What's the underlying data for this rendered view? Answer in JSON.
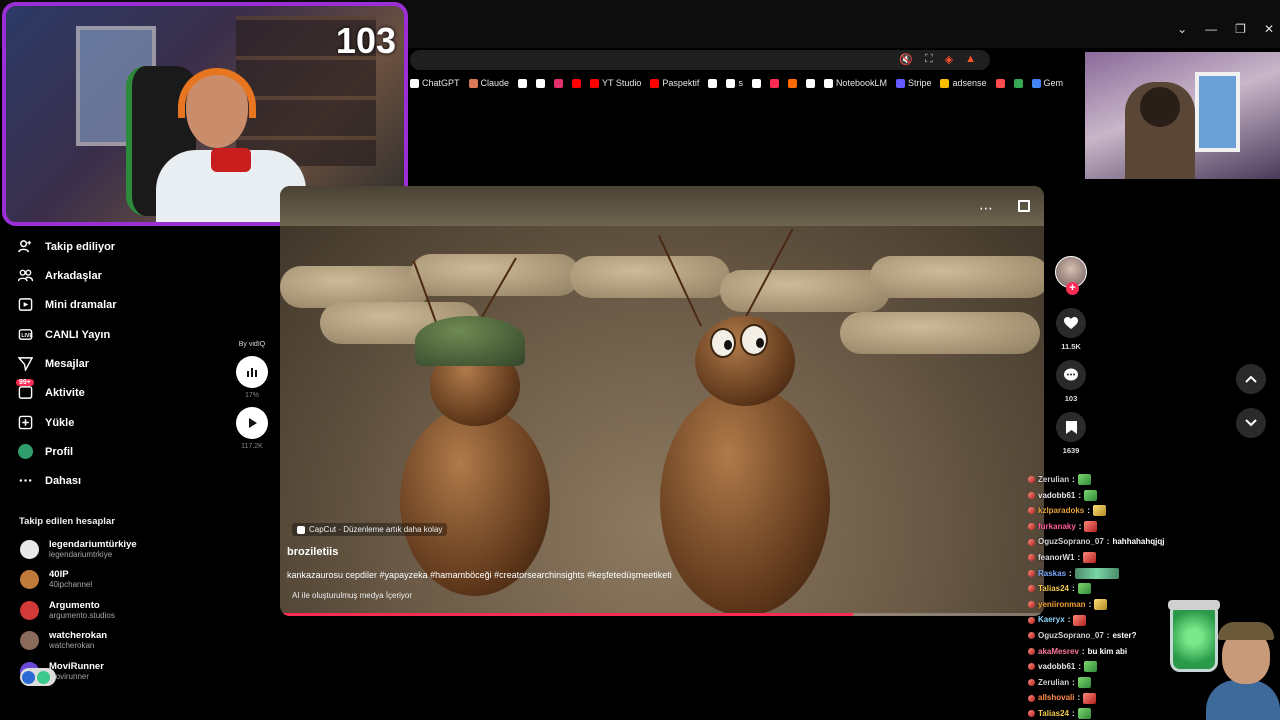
{
  "browser": {
    "bookmarks": [
      {
        "label": "ChatGPT",
        "color": "#ffffff"
      },
      {
        "label": "Claude",
        "color": "#d97757"
      },
      {
        "label": "",
        "color": "#ffffff"
      },
      {
        "label": "",
        "color": "#ffffff"
      },
      {
        "label": "",
        "color": "#e1306c"
      },
      {
        "label": "",
        "color": "#ff0000"
      },
      {
        "label": "YT Studio",
        "color": "#ff0000"
      },
      {
        "label": "Paspektif",
        "color": "#ff0000"
      },
      {
        "label": "",
        "color": "#ffffff"
      },
      {
        "label": "s",
        "color": "#ffffff"
      },
      {
        "label": "",
        "color": "#ffffff"
      },
      {
        "label": "",
        "color": "#fe2c55"
      },
      {
        "label": "",
        "color": "#ff6a00"
      },
      {
        "label": "",
        "color": "#ffffff"
      },
      {
        "label": "NotebookLM",
        "color": "#ffffff"
      },
      {
        "label": "Stripe",
        "color": "#635bff"
      },
      {
        "label": "adsense",
        "color": "#fbbc04"
      },
      {
        "label": "",
        "color": "#ff4d4d"
      },
      {
        "label": "",
        "color": "#34a853"
      },
      {
        "label": "Gem",
        "color": "#4285f4"
      }
    ]
  },
  "stream": {
    "counter": "103"
  },
  "sidebar": {
    "nav": [
      {
        "label": "Takip ediliyor",
        "icon": "following-icon"
      },
      {
        "label": "Arkadaşlar",
        "icon": "friends-icon"
      },
      {
        "label": "Mini dramalar",
        "icon": "mini-drama-icon"
      },
      {
        "label": "CANLI Yayın",
        "icon": "live-icon"
      },
      {
        "label": "Mesajlar",
        "icon": "messages-icon"
      },
      {
        "label": "Aktivite",
        "icon": "activity-icon",
        "badge": "99+"
      },
      {
        "label": "Yükle",
        "icon": "upload-icon"
      },
      {
        "label": "Profil",
        "icon": "profile-avatar"
      },
      {
        "label": "Dahası",
        "icon": "more-icon"
      }
    ],
    "following_title": "Takip edilen hesaplar",
    "accounts": [
      {
        "name": "legendariumtürkiye",
        "handle": "legendariumtrkiye",
        "color": "#e8e8e8"
      },
      {
        "name": "40IP",
        "handle": "40ipchannel",
        "color": "#c07a3a"
      },
      {
        "name": "Argumento",
        "handle": "argumento.studios",
        "color": "#d23a3a"
      },
      {
        "name": "watcherokan",
        "handle": "watcherokan",
        "color": "#8a6a5a"
      },
      {
        "name": "MoviRunner",
        "handle": "movirunner",
        "color": "#6a4ad6"
      }
    ]
  },
  "vidiq": {
    "label": "By vidIQ",
    "percent": "17%",
    "views": "117.2K"
  },
  "video": {
    "capcut_label": "CapCut · Düzenleme artık daha kolay",
    "author": "broziletiis",
    "caption": "kankazaurosu cepdiler #yapayzeka #hamamböceği #creatorsearchinsights #keşfetedüşmeetiketi",
    "ai_label": "AI ile oluşturulmuş medya İçeriyor",
    "progress": 0.75
  },
  "actions": {
    "likes": "11.5K",
    "comments": "103",
    "saves": "1639"
  },
  "chat": [
    {
      "user": "Zerulian",
      "color": "#cfcfcf",
      "msg": "",
      "emote": "green"
    },
    {
      "user": "vadobb61",
      "color": "#e6e6e6",
      "msg": "",
      "emote": "green"
    },
    {
      "user": "kzlparadoks",
      "color": "#e6a23c",
      "msg": "",
      "emote": "yellow"
    },
    {
      "user": "furkanaky",
      "color": "#ff5a9a",
      "msg": "",
      "emote": "red"
    },
    {
      "user": "OguzSoprano_07",
      "color": "#d2d2d2",
      "msg": "hahhahahqjqj",
      "emote": ""
    },
    {
      "user": "feanorW1",
      "color": "#dcdcdc",
      "msg": "",
      "emote": "red"
    },
    {
      "user": "Raskas",
      "color": "#7aa6ff",
      "msg": "",
      "emote": "long"
    },
    {
      "user": "Talias24",
      "color": "#f2c94c",
      "msg": "",
      "emote": "green"
    },
    {
      "user": "yeniironman",
      "color": "#f0a030",
      "msg": "",
      "emote": "yellow"
    },
    {
      "user": "Kaeryx",
      "color": "#8ad6ff",
      "msg": "",
      "emote": "red"
    },
    {
      "user": "OguzSoprano_07",
      "color": "#d2d2d2",
      "msg": "ester?",
      "emote": ""
    },
    {
      "user": "akaMesrev",
      "color": "#ff7a9a",
      "msg": "bu kim abi",
      "emote": ""
    },
    {
      "user": "vadobb61",
      "color": "#e6e6e6",
      "msg": "",
      "emote": "green"
    },
    {
      "user": "Zerulian",
      "color": "#cfcfcf",
      "msg": "",
      "emote": "green"
    },
    {
      "user": "allshovali",
      "color": "#ff8a4a",
      "msg": "",
      "emote": "red"
    },
    {
      "user": "Talias24",
      "color": "#f2c94c",
      "msg": "",
      "emote": "green"
    }
  ]
}
